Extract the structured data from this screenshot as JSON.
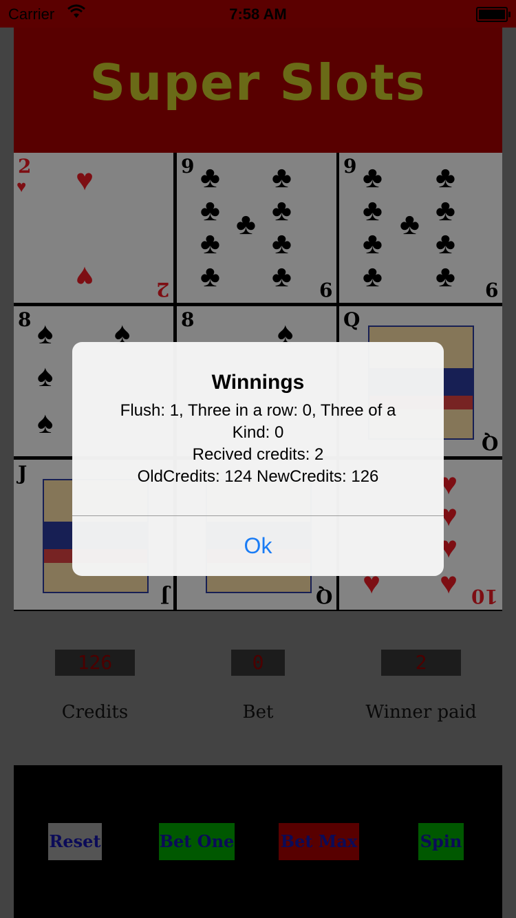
{
  "status_bar": {
    "carrier": "Carrier",
    "time": "7:58 AM",
    "wifi_icon": "wifi-icon",
    "battery_icon": "battery-icon"
  },
  "app": {
    "title": "Super Slots"
  },
  "cards": [
    {
      "rank": "2",
      "suit": "♥",
      "color": "red"
    },
    {
      "rank": "9",
      "suit": "♣",
      "color": "black"
    },
    {
      "rank": "9",
      "suit": "♣",
      "color": "black"
    },
    {
      "rank": "8",
      "suit": "♠",
      "color": "black"
    },
    {
      "rank": "8",
      "suit": "♠",
      "color": "black"
    },
    {
      "rank": "Q",
      "suit": "♣",
      "color": "black"
    },
    {
      "rank": "J",
      "suit": "♣",
      "color": "black"
    },
    {
      "rank": "Q",
      "suit": "♣",
      "color": "black"
    },
    {
      "rank": "10",
      "suit": "♥",
      "color": "red"
    }
  ],
  "stats": {
    "credits_value": "126",
    "credits_label": "Credits",
    "bet_value": "0",
    "bet_label": "Bet",
    "winner_value": "2",
    "winner_label": "Winner paid"
  },
  "controls": {
    "reset": "Reset",
    "bet_one": "Bet One",
    "bet_max": "Bet Max",
    "spin": "Spin"
  },
  "colors": {
    "header_bg": "#a00000",
    "title": "#c2c22b",
    "reset_bg": "#9a9a9a",
    "bet_one_bg": "#00a000",
    "bet_max_bg": "#a00000",
    "spin_bg": "#00a000",
    "button_text": "#1414a0",
    "meter_text": "#8a0000",
    "alert_button": "#1a7cf5"
  },
  "alert": {
    "title": "Winnings",
    "line1": "Flush: 1, Three in a row: 0, Three of a",
    "line2": "Kind: 0",
    "line3": "Recived credits: 2",
    "line4": "OldCredits: 124 NewCredits: 126",
    "button": "Ok"
  }
}
